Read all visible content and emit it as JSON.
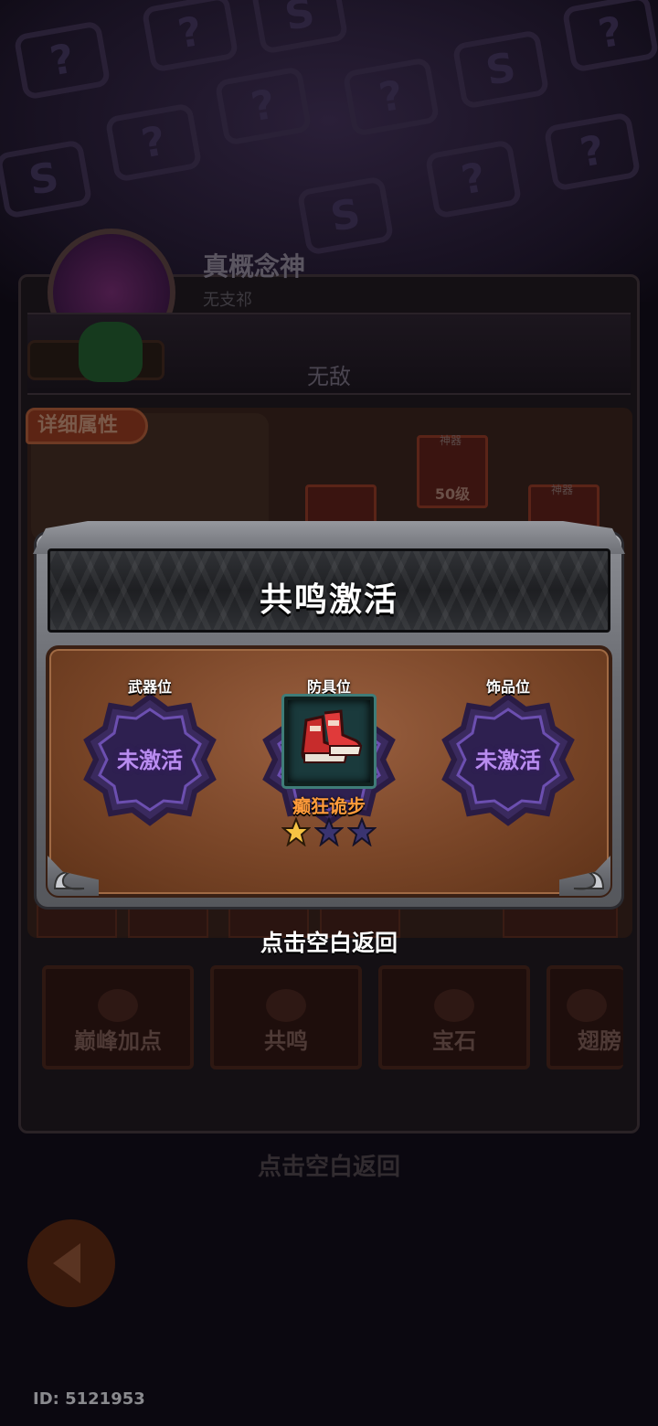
{
  "background": {
    "character_name": "真概念神",
    "character_subtitle": "无支祁",
    "status_text": "无敌",
    "detail_tab_label": "详细属性",
    "equip_slots": [
      {
        "tag": "神器",
        "level": "50级"
      },
      {
        "tag": "神器",
        "level": ""
      }
    ],
    "tabs": [
      {
        "label": "巅峰加点",
        "icon": "upgrade-house-icon"
      },
      {
        "label": "共鸣",
        "icon": "resonance-icon"
      },
      {
        "label": "宝石",
        "icon": "gem-icon"
      },
      {
        "label": "翅膀",
        "icon": "wings-icon"
      }
    ],
    "return_hint": "点击空白返回",
    "user_id": "ID: 5121953"
  },
  "modal": {
    "title": "共鸣激活",
    "slots": [
      {
        "label": "武器位",
        "state": "未激活"
      },
      {
        "label": "防具位",
        "item_name": "癫狂诡步",
        "item_icon": "red-boots-icon",
        "stars_filled": 1,
        "stars_total": 3
      },
      {
        "label": "饰品位",
        "state": "未激活"
      }
    ],
    "return_hint": "点击空白返回"
  },
  "colors": {
    "accent_purple": "#b98cf0",
    "item_name_orange": "#ff9b3a",
    "star_gold": "#f6c343",
    "star_empty": "#3a3470"
  }
}
